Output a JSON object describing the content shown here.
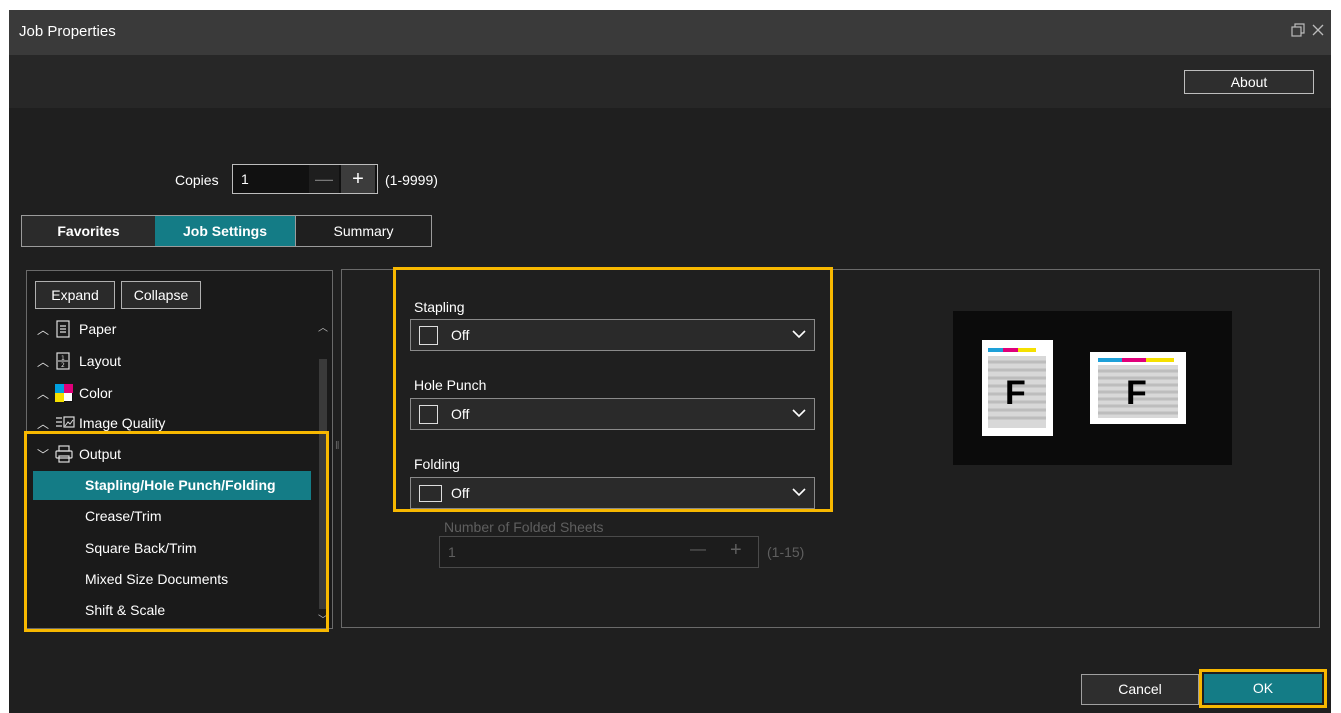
{
  "window": {
    "title": "Job Properties"
  },
  "header": {
    "about_label": "About"
  },
  "copies": {
    "label": "Copies",
    "value": "1",
    "minus": "—",
    "plus": "+",
    "range": "(1-9999)"
  },
  "tabs": [
    {
      "label": "Favorites"
    },
    {
      "label": "Job Settings"
    },
    {
      "label": "Summary"
    }
  ],
  "tree": {
    "expand_label": "Expand",
    "collapse_label": "Collapse",
    "items": [
      {
        "label": "Paper",
        "icon": "paper-icon"
      },
      {
        "label": "Layout",
        "icon": "layout-icon"
      },
      {
        "label": "Color",
        "icon": "color-icon"
      },
      {
        "label": "Image Quality",
        "icon": "image-quality-icon"
      },
      {
        "label": "Output",
        "icon": "printer-icon"
      }
    ],
    "output_items": [
      {
        "label": "Stapling/Hole Punch/Folding"
      },
      {
        "label": "Crease/Trim"
      },
      {
        "label": "Square Back/Trim"
      },
      {
        "label": "Mixed Size Documents"
      },
      {
        "label": "Shift & Scale"
      }
    ]
  },
  "settings": {
    "stapling": {
      "label": "Stapling",
      "value": "Off"
    },
    "hole_punch": {
      "label": "Hole Punch",
      "value": "Off"
    },
    "folding": {
      "label": "Folding",
      "value": "Off"
    },
    "folded_sheets": {
      "label": "Number of Folded Sheets",
      "value": "1",
      "range": "(1-15)"
    }
  },
  "preview": {
    "letter": "F"
  },
  "footer": {
    "cancel_label": "Cancel",
    "ok_label": "OK"
  },
  "colors": {
    "accent": "#147c86",
    "highlight": "#f7b800",
    "background": "#1f1f1f"
  }
}
